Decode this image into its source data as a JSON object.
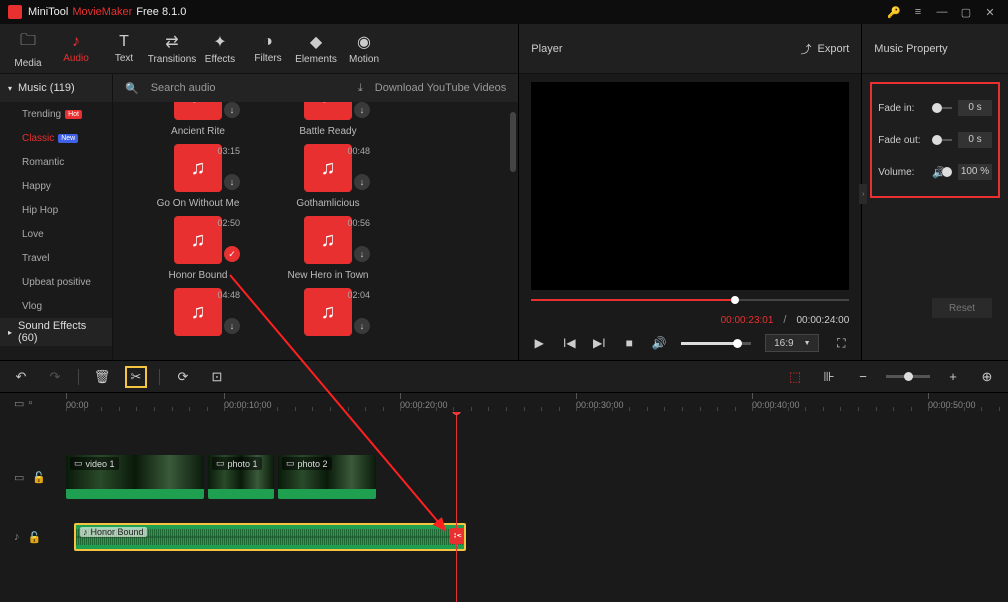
{
  "titlebar": {
    "appname_a": "MiniTool",
    "appname_b": "MovieMaker",
    "version": "Free 8.1.0"
  },
  "tabs": {
    "media": "Media",
    "audio": "Audio",
    "text": "Text",
    "transitions": "Transitions",
    "effects": "Effects",
    "filters": "Filters",
    "elements": "Elements",
    "motion": "Motion"
  },
  "sidebar": {
    "music_header": "Music (119)",
    "items": [
      "Trending",
      "Classic",
      "Romantic",
      "Happy",
      "Hip Hop",
      "Love",
      "Travel",
      "Upbeat positive",
      "Vlog"
    ],
    "badges": {
      "0": "Hot",
      "1": "New"
    },
    "sfx_header": "Sound Effects (60)"
  },
  "mediabar": {
    "search": "Search audio",
    "download": "Download YouTube Videos"
  },
  "musicgrid": {
    "col1": [
      {
        "label": "Ancient Rite",
        "dur": ""
      },
      {
        "label": "Go On Without Me",
        "dur": "03:15"
      },
      {
        "label": "Honor Bound",
        "dur": "02:50",
        "checked": true
      },
      {
        "label": "",
        "dur": "04:48"
      }
    ],
    "col2": [
      {
        "label": "Battle Ready",
        "dur": ""
      },
      {
        "label": "Gothamlicious",
        "dur": "00:48"
      },
      {
        "label": "New Hero in Town",
        "dur": "00:56"
      },
      {
        "label": "",
        "dur": "02:04"
      }
    ]
  },
  "player": {
    "title": "Player",
    "export": "Export",
    "current": "00:00:23:01",
    "total": "00:00:24:00",
    "aspect": "16:9"
  },
  "props": {
    "title": "Music Property",
    "fadein_label": "Fade in:",
    "fadein_val": "0 s",
    "fadeout_label": "Fade out:",
    "fadeout_val": "0 s",
    "volume_label": "Volume:",
    "volume_val": "100 %",
    "reset": "Reset"
  },
  "ruler": {
    "marks": [
      {
        "pos": 66,
        "label": "00:00"
      },
      {
        "pos": 224,
        "label": "00:00:10:00"
      },
      {
        "pos": 400,
        "label": "00:00:20:00"
      },
      {
        "pos": 576,
        "label": "00:00:30:00"
      },
      {
        "pos": 752,
        "label": "00:00:40:00"
      },
      {
        "pos": 928,
        "label": "00:00:50:00"
      }
    ]
  },
  "clips": {
    "v1": "video 1",
    "p1": "photo 1",
    "p2": "photo 2",
    "audio": "Honor Bound"
  }
}
